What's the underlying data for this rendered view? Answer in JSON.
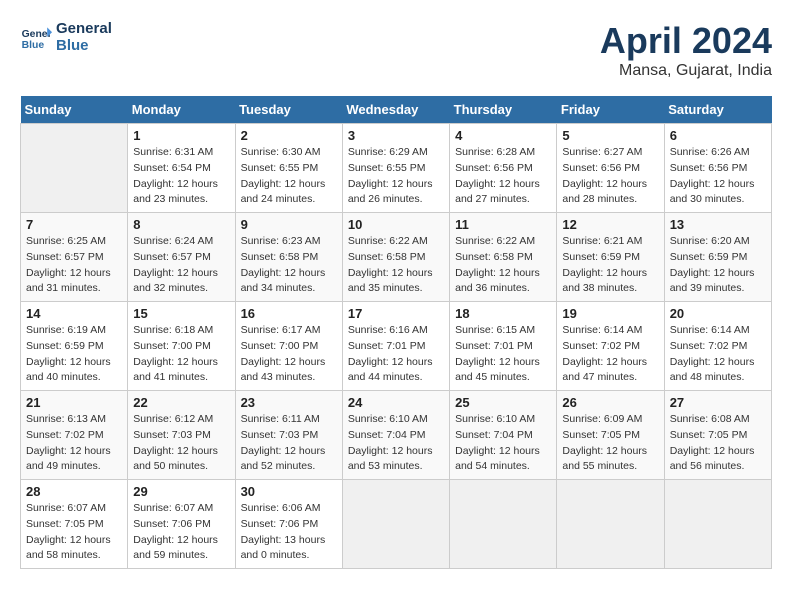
{
  "header": {
    "logo_line1": "General",
    "logo_line2": "Blue",
    "month": "April 2024",
    "location": "Mansa, Gujarat, India"
  },
  "weekdays": [
    "Sunday",
    "Monday",
    "Tuesday",
    "Wednesday",
    "Thursday",
    "Friday",
    "Saturday"
  ],
  "weeks": [
    [
      {
        "day": "",
        "empty": true
      },
      {
        "day": "1",
        "sunrise": "6:31 AM",
        "sunset": "6:54 PM",
        "daylight": "12 hours and 23 minutes."
      },
      {
        "day": "2",
        "sunrise": "6:30 AM",
        "sunset": "6:55 PM",
        "daylight": "12 hours and 24 minutes."
      },
      {
        "day": "3",
        "sunrise": "6:29 AM",
        "sunset": "6:55 PM",
        "daylight": "12 hours and 26 minutes."
      },
      {
        "day": "4",
        "sunrise": "6:28 AM",
        "sunset": "6:56 PM",
        "daylight": "12 hours and 27 minutes."
      },
      {
        "day": "5",
        "sunrise": "6:27 AM",
        "sunset": "6:56 PM",
        "daylight": "12 hours and 28 minutes."
      },
      {
        "day": "6",
        "sunrise": "6:26 AM",
        "sunset": "6:56 PM",
        "daylight": "12 hours and 30 minutes."
      }
    ],
    [
      {
        "day": "7",
        "sunrise": "6:25 AM",
        "sunset": "6:57 PM",
        "daylight": "12 hours and 31 minutes."
      },
      {
        "day": "8",
        "sunrise": "6:24 AM",
        "sunset": "6:57 PM",
        "daylight": "12 hours and 32 minutes."
      },
      {
        "day": "9",
        "sunrise": "6:23 AM",
        "sunset": "6:58 PM",
        "daylight": "12 hours and 34 minutes."
      },
      {
        "day": "10",
        "sunrise": "6:22 AM",
        "sunset": "6:58 PM",
        "daylight": "12 hours and 35 minutes."
      },
      {
        "day": "11",
        "sunrise": "6:22 AM",
        "sunset": "6:58 PM",
        "daylight": "12 hours and 36 minutes."
      },
      {
        "day": "12",
        "sunrise": "6:21 AM",
        "sunset": "6:59 PM",
        "daylight": "12 hours and 38 minutes."
      },
      {
        "day": "13",
        "sunrise": "6:20 AM",
        "sunset": "6:59 PM",
        "daylight": "12 hours and 39 minutes."
      }
    ],
    [
      {
        "day": "14",
        "sunrise": "6:19 AM",
        "sunset": "6:59 PM",
        "daylight": "12 hours and 40 minutes."
      },
      {
        "day": "15",
        "sunrise": "6:18 AM",
        "sunset": "7:00 PM",
        "daylight": "12 hours and 41 minutes."
      },
      {
        "day": "16",
        "sunrise": "6:17 AM",
        "sunset": "7:00 PM",
        "daylight": "12 hours and 43 minutes."
      },
      {
        "day": "17",
        "sunrise": "6:16 AM",
        "sunset": "7:01 PM",
        "daylight": "12 hours and 44 minutes."
      },
      {
        "day": "18",
        "sunrise": "6:15 AM",
        "sunset": "7:01 PM",
        "daylight": "12 hours and 45 minutes."
      },
      {
        "day": "19",
        "sunrise": "6:14 AM",
        "sunset": "7:02 PM",
        "daylight": "12 hours and 47 minutes."
      },
      {
        "day": "20",
        "sunrise": "6:14 AM",
        "sunset": "7:02 PM",
        "daylight": "12 hours and 48 minutes."
      }
    ],
    [
      {
        "day": "21",
        "sunrise": "6:13 AM",
        "sunset": "7:02 PM",
        "daylight": "12 hours and 49 minutes."
      },
      {
        "day": "22",
        "sunrise": "6:12 AM",
        "sunset": "7:03 PM",
        "daylight": "12 hours and 50 minutes."
      },
      {
        "day": "23",
        "sunrise": "6:11 AM",
        "sunset": "7:03 PM",
        "daylight": "12 hours and 52 minutes."
      },
      {
        "day": "24",
        "sunrise": "6:10 AM",
        "sunset": "7:04 PM",
        "daylight": "12 hours and 53 minutes."
      },
      {
        "day": "25",
        "sunrise": "6:10 AM",
        "sunset": "7:04 PM",
        "daylight": "12 hours and 54 minutes."
      },
      {
        "day": "26",
        "sunrise": "6:09 AM",
        "sunset": "7:05 PM",
        "daylight": "12 hours and 55 minutes."
      },
      {
        "day": "27",
        "sunrise": "6:08 AM",
        "sunset": "7:05 PM",
        "daylight": "12 hours and 56 minutes."
      }
    ],
    [
      {
        "day": "28",
        "sunrise": "6:07 AM",
        "sunset": "7:05 PM",
        "daylight": "12 hours and 58 minutes."
      },
      {
        "day": "29",
        "sunrise": "6:07 AM",
        "sunset": "7:06 PM",
        "daylight": "12 hours and 59 minutes."
      },
      {
        "day": "30",
        "sunrise": "6:06 AM",
        "sunset": "7:06 PM",
        "daylight": "13 hours and 0 minutes."
      },
      {
        "day": "",
        "empty": true
      },
      {
        "day": "",
        "empty": true
      },
      {
        "day": "",
        "empty": true
      },
      {
        "day": "",
        "empty": true
      }
    ]
  ]
}
